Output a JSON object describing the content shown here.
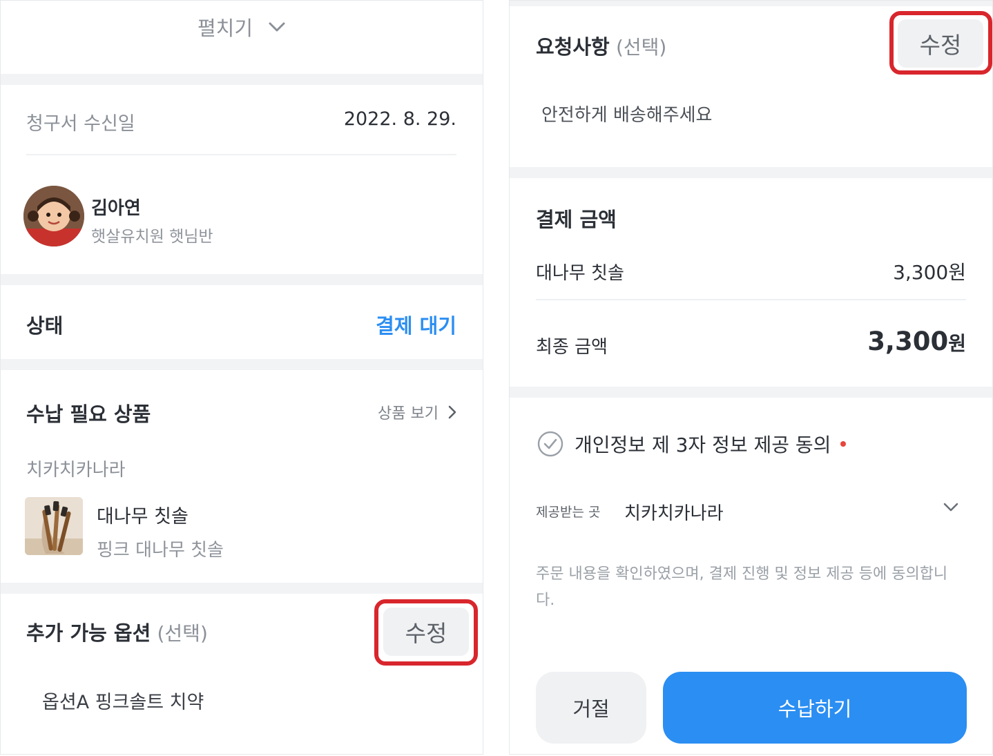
{
  "left": {
    "expand": {
      "label": "펼치기",
      "icon": "chevron-down-icon"
    },
    "invoice": {
      "label": "청구서 수신일",
      "date": "2022. 8. 29."
    },
    "student": {
      "name": "김아연",
      "class": "햇살유치원 햇님반",
      "avatar_icon": "child-avatar"
    },
    "status": {
      "label": "상태",
      "value": "결제 대기",
      "value_color": "#2b8ef2"
    },
    "products": {
      "title": "수납 필요 상품",
      "view_link": "상품 보기",
      "view_icon": "chevron-right-icon",
      "vendor": "치카치카나라",
      "item": {
        "name": "대나무 칫솔",
        "option": "핑크 대나무 칫솔",
        "thumb_icon": "bamboo-toothbrush-image"
      }
    },
    "options": {
      "title": "추가 가능 옵션",
      "optional": "(선택)",
      "edit_label": "수정",
      "selected": "옵션A 핑크솔트 치약"
    }
  },
  "right": {
    "request": {
      "title": "요청사항",
      "optional": "(선택)",
      "edit_label": "수정",
      "text": "안전하게 배송해주세요"
    },
    "payment": {
      "title": "결제 금액",
      "item_label": "대나무 칫솔",
      "item_price": "3,300원",
      "final_label": "최종 금액",
      "final_amount": "3,300",
      "final_unit": "원"
    },
    "consent": {
      "title": "개인정보 제 3자 정보 제공 동의",
      "check_icon": "check-circle-icon",
      "required_dot_color": "#e8453c",
      "recipient_label": "제공받는 곳",
      "recipient_value": "치카치카나라",
      "text": "주문 내용을 확인하였으며, 결제 진행 및 정보 제공 등에 동의합니다."
    },
    "actions": {
      "reject": "거절",
      "pay": "수납하기",
      "pay_color": "#2b8ef2"
    }
  },
  "colors": {
    "highlight": "#d8262c",
    "accent": "#2b8ef2"
  }
}
